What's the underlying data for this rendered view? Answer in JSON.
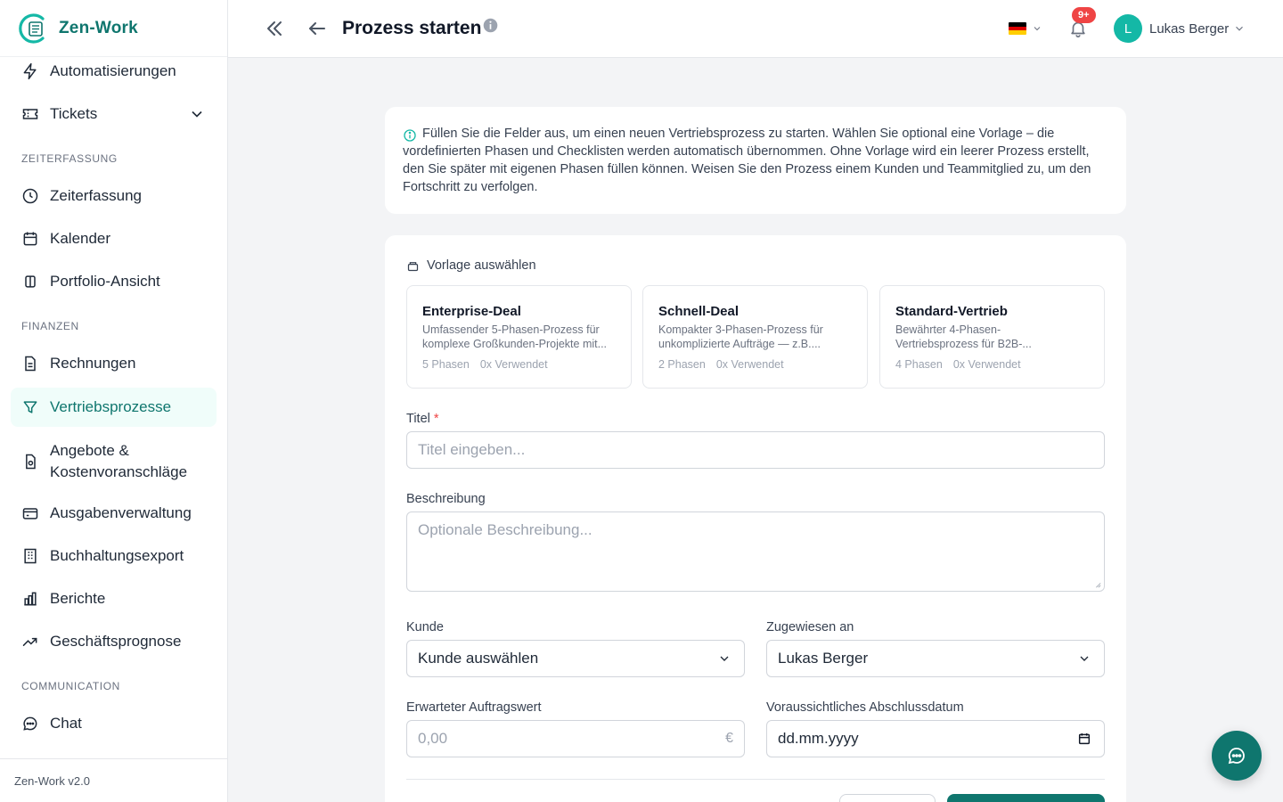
{
  "app": {
    "name": "Zen-Work",
    "version": "Zen-Work v2.0"
  },
  "sidebar": {
    "items_top": [
      {
        "label": "Automatisierungen",
        "icon": "bolt-icon"
      },
      {
        "label": "Tickets",
        "icon": "ticket-icon"
      }
    ],
    "sections": [
      {
        "title": "ZEITERFASSUNG",
        "items": [
          {
            "label": "Zeiterfassung",
            "icon": "clock-icon"
          },
          {
            "label": "Kalender",
            "icon": "calendar-icon"
          },
          {
            "label": "Portfolio-Ansicht",
            "icon": "columns-icon"
          }
        ]
      },
      {
        "title": "FINANZEN",
        "items": [
          {
            "label": "Rechnungen",
            "icon": "document-icon"
          },
          {
            "label": "Vertriebsprozesse",
            "icon": "funnel-icon",
            "active": true
          },
          {
            "label": "Angebote & Kostenvoranschläge",
            "icon": "quote-icon"
          },
          {
            "label": "Ausgabenverwaltung",
            "icon": "wallet-icon"
          },
          {
            "label": "Buchhaltungsexport",
            "icon": "building-icon"
          },
          {
            "label": "Berichte",
            "icon": "bar-chart-icon"
          },
          {
            "label": "Geschäftsprognose",
            "icon": "trend-up-icon"
          }
        ]
      },
      {
        "title": "COMMUNICATION",
        "items": [
          {
            "label": "Chat",
            "icon": "chat-icon"
          }
        ]
      }
    ]
  },
  "header": {
    "title": "Prozess starten",
    "language": "de",
    "notification_badge": "9+",
    "user": {
      "initial": "L",
      "name": "Lukas Berger"
    }
  },
  "info": {
    "text": "Füllen Sie die Felder aus, um einen neuen Vertriebsprozess zu starten. Wählen Sie optional eine Vorlage – die vordefinierten Phasen und Checklisten werden automatisch übernommen. Ohne Vorlage wird ein leerer Prozess erstellt, den Sie später mit eigenen Phasen füllen können. Weisen Sie den Prozess einem Kunden und Teammitglied zu, um den Fortschritt zu verfolgen."
  },
  "templates": {
    "heading": "Vorlage auswählen",
    "items": [
      {
        "name": "Enterprise-Deal",
        "desc_line1": "Umfassender 5-Phasen-Prozess für",
        "desc_line2": "komplexe Großkunden-Projekte mit...",
        "phases": "5 Phasen",
        "used": "0x Verwendet"
      },
      {
        "name": "Schnell-Deal",
        "desc_line1": "Kompakter 3-Phasen-Prozess für",
        "desc_line2": "unkomplizierte Aufträge — z.B....",
        "phases": "2 Phasen",
        "used": "0x Verwendet"
      },
      {
        "name": "Standard-Vertrieb",
        "desc_line1": "Bewährter 4-Phasen-",
        "desc_line2": "Vertriebsprozess für B2B-...",
        "phases": "4 Phasen",
        "used": "0x Verwendet"
      }
    ]
  },
  "form": {
    "title_label": "Titel",
    "title_required": "*",
    "title_placeholder": "Titel eingeben...",
    "description_label": "Beschreibung",
    "description_placeholder": "Optionale Beschreibung...",
    "customer_label": "Kunde",
    "customer_value": "Kunde auswählen",
    "assigned_label": "Zugewiesen an",
    "assigned_value": "Lukas Berger",
    "value_label": "Erwarteter Auftragswert",
    "value_placeholder": "0,00",
    "currency": "€",
    "date_label": "Voraussichtliches Abschlussdatum",
    "date_value": "dd.mm.yyyy"
  },
  "colors": {
    "brand": "#0f766e",
    "accent": "#14b8a6",
    "badge": "#ef4444",
    "active_bg": "#f0fdfa"
  }
}
